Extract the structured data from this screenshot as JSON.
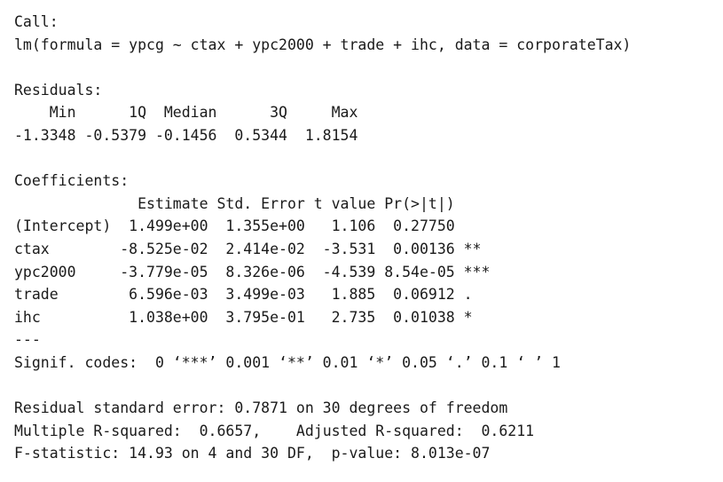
{
  "output": {
    "call_header": "Call:",
    "call_formula": "lm(formula = ypcg ~ ctax + ypc2000 + trade + ihc, data = corporateTax)",
    "residuals_header": "Residuals:",
    "residuals_labels": "    Min      1Q  Median      3Q     Max",
    "residuals_values": "-1.3348 -0.5379 -0.1456  0.5344  1.8154",
    "coefficients_header": "Coefficients:",
    "coef_columns": "              Estimate Std. Error t value Pr(>|t|)",
    "coef_rows": [
      "(Intercept)  1.499e+00  1.355e+00   1.106  0.27750",
      "ctax        -8.525e-02  2.414e-02  -3.531  0.00136 **",
      "ypc2000     -3.779e-05  8.326e-06  -4.539 8.54e-05 ***",
      "trade        6.596e-03  3.499e-03   1.885  0.06912 .",
      "ihc          1.038e+00  3.795e-01   2.735  0.01038 *"
    ],
    "separator": "---",
    "signif_codes": "Signif. codes:  0 ‘***’ 0.001 ‘**’ 0.01 ‘*’ 0.05 ‘.’ 0.1 ‘ ’ 1",
    "residual_se": "Residual standard error: 0.7871 on 30 degrees of freedom",
    "r_squared": "Multiple R-squared:  0.6657,\tAdjusted R-squared:  0.6211",
    "f_statistic": "F-statistic: 14.93 on 4 and 30 DF,  p-value: 8.013e-07"
  }
}
